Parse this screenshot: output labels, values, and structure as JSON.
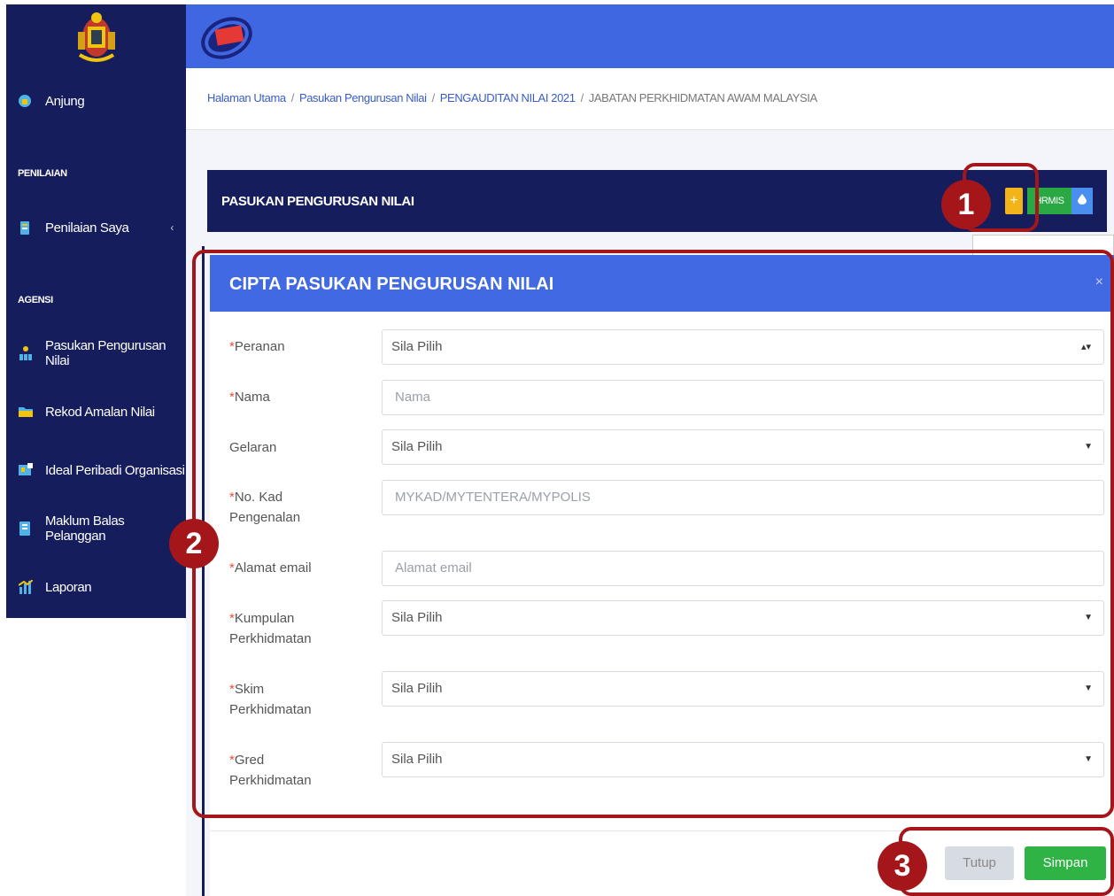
{
  "sidebar": {
    "sections": {
      "penilaian": "PENILAIAN",
      "agensi": "AGENSI"
    },
    "items": [
      {
        "label": "Anjung",
        "icon": "home-icon"
      },
      {
        "label": "Penilaian Saya",
        "icon": "clipboard-icon"
      },
      {
        "label": "Pasukan Pengurusan Nilai",
        "icon": "team-icon"
      },
      {
        "label": "Rekod Amalan Nilai",
        "icon": "folder-icon"
      },
      {
        "label": "Ideal Peribadi Organisasi",
        "icon": "profile-card-icon"
      },
      {
        "label": "Maklum Balas Pelanggan",
        "icon": "feedback-book-icon"
      },
      {
        "label": "Laporan",
        "icon": "report-chart-icon"
      }
    ],
    "penilaian_chevron": "‹"
  },
  "breadcrumb": [
    "Halaman Utama",
    "Pasukan Pengurusan Nilai",
    "PENGAUDITAN NILAI 2021",
    "JABATAN PERKHIDMATAN AWAM MALAYSIA"
  ],
  "card": {
    "title": "PASUKAN PENGURUSAN NILAI",
    "add_label": "+",
    "hrmis_label": "HRMIS"
  },
  "modal": {
    "title": "CIPTA PASUKAN PENGURUSAN NILAI",
    "close_label": "×",
    "fields": {
      "peranan": {
        "label": "Peranan",
        "value": "Sila Pilih"
      },
      "nama": {
        "label": "Nama",
        "placeholder": "Nama"
      },
      "gelaran": {
        "label": "Gelaran",
        "value": "Sila Pilih"
      },
      "no_kad": {
        "label_1": "No. Kad",
        "label_2": "Pengenalan",
        "placeholder": "MYKAD/MYTENTERA/MYPOLIS"
      },
      "email": {
        "label": "Alamat email",
        "placeholder": "Alamat email"
      },
      "kumpulan": {
        "label_1": "Kumpulan",
        "label_2": "Perkhidmatan",
        "value": "Sila Pilih"
      },
      "skim": {
        "label_1": "Skim",
        "label_2": "Perkhidmatan",
        "value": "Sila Pilih"
      },
      "gred": {
        "label_1": "Gred",
        "label_2": "Perkhidmatan",
        "value": "Sila Pilih"
      }
    },
    "required_mark": "*",
    "tutup_label": "Tutup",
    "simpan_label": "Simpan"
  },
  "annotations": {
    "step1": "1",
    "step2": "2",
    "step3": "3"
  },
  "colors": {
    "sidebar": "#151d5c",
    "topbar": "#3f67e2",
    "annotation": "#a4161a",
    "success": "#2fb344",
    "warning": "#f2b418"
  }
}
